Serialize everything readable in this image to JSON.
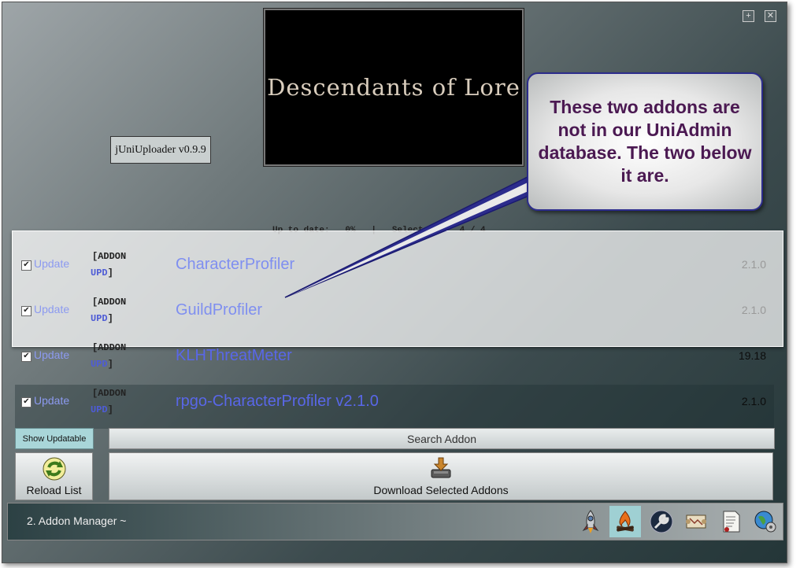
{
  "window": {
    "maximize_label": "+",
    "close_label": "✕",
    "logo_text": "Descendants of Lore",
    "version": "jUniUploader v0.9.9"
  },
  "status": {
    "text": "Up to date:   0%   |   Selected:    4 / 4"
  },
  "addons": [
    {
      "checked": "✔",
      "update_label": "Update",
      "tag_line1": "[ADDON",
      "tag_upd": "UPD",
      "tag_close": "]",
      "name": "CharacterProfiler",
      "version": "2.1.0"
    },
    {
      "checked": "✔",
      "update_label": "Update",
      "tag_line1": "[ADDON",
      "tag_upd": "UPD",
      "tag_close": "]",
      "name": "GuildProfiler",
      "version": "2.1.0"
    },
    {
      "checked": "✔",
      "update_label": "Update",
      "tag_line1": "[ADDON",
      "tag_upd": "UPD",
      "tag_close": "]",
      "name": "KLHThreatMeter",
      "version": "19.18"
    },
    {
      "checked": "✔",
      "update_label": "Update",
      "tag_line1": "[ADDON",
      "tag_upd": "UPD",
      "tag_close": "]",
      "name": "rpgo-CharacterProfiler v2.1.0",
      "version": "2.1.0"
    }
  ],
  "controls": {
    "show_updatable": "Show Updatable",
    "search_addon": "Search Addon",
    "reload_list": "Reload List",
    "download_selected": "Download Selected Addons"
  },
  "bottom_bar": {
    "title": "2.  Addon Manager ~",
    "tools": [
      "rocket-icon",
      "campfire-icon",
      "wrench-icon",
      "scroll-map-icon",
      "document-icon",
      "globe-settings-icon"
    ]
  },
  "callout": {
    "text": "These two addons are not in our UniAdmin database.  The two below it are."
  },
  "colors": {
    "accent": "#7f8ff0",
    "callout_border": "#2c2c8c",
    "callout_text": "#4b1952",
    "active_tool": "#9fd0d3"
  }
}
